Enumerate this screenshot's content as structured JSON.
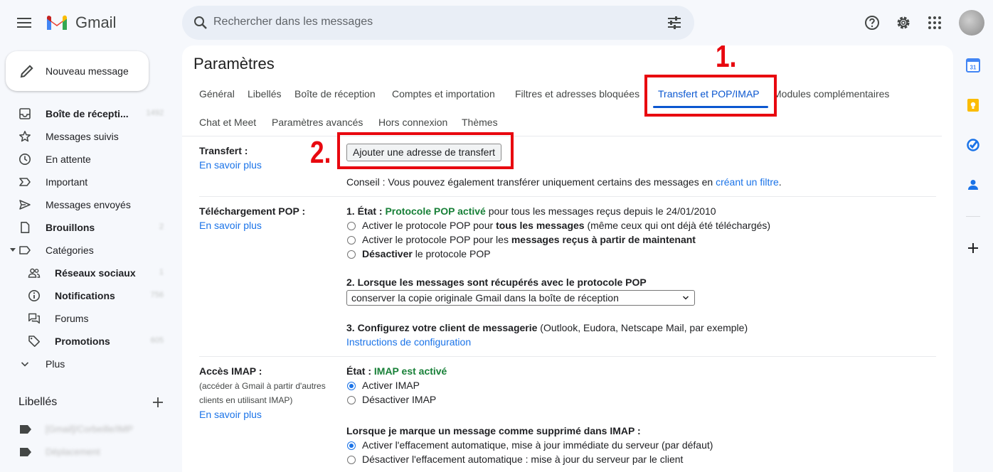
{
  "app": {
    "name": "Gmail",
    "search_placeholder": "Rechercher dans les messages"
  },
  "compose": {
    "label": "Nouveau message"
  },
  "nav": {
    "items": [
      {
        "label": "Boîte de récepti...",
        "bold": true,
        "count": "1492",
        "icon": "inbox-icon"
      },
      {
        "label": "Messages suivis",
        "bold": false,
        "count": "",
        "icon": "star-icon"
      },
      {
        "label": "En attente",
        "bold": false,
        "count": "",
        "icon": "clock-icon"
      },
      {
        "label": "Important",
        "bold": false,
        "count": "",
        "icon": "important-icon"
      },
      {
        "label": "Messages envoyés",
        "bold": false,
        "count": "",
        "icon": "send-icon"
      },
      {
        "label": "Brouillons",
        "bold": true,
        "count": "2",
        "icon": "draft-icon"
      },
      {
        "label": "Catégories",
        "bold": false,
        "count": "",
        "icon": "label-icon"
      }
    ],
    "categories": [
      {
        "label": "Réseaux sociaux",
        "bold": true,
        "count": "1",
        "icon": "people-icon"
      },
      {
        "label": "Notifications",
        "bold": true,
        "count": "756",
        "icon": "info-icon"
      },
      {
        "label": "Forums",
        "bold": false,
        "count": "",
        "icon": "forum-icon"
      },
      {
        "label": "Promotions",
        "bold": true,
        "count": "605",
        "icon": "tag-icon"
      }
    ],
    "more": "Plus",
    "labels_title": "Libellés",
    "labels": [
      {
        "name": "[Gmail]/Corbeille/IMP"
      },
      {
        "name": "Déplacement"
      }
    ]
  },
  "settings": {
    "title": "Paramètres",
    "tabs_row1": [
      "Général",
      "Libellés",
      "Boîte de réception",
      "Comptes et importation",
      "Filtres et adresses bloquées",
      "Transfert et POP/IMAP",
      "Modules complémentaires"
    ],
    "tabs_row2": [
      "Chat et Meet",
      "Paramètres avancés",
      "Hors connexion",
      "Thèmes"
    ],
    "active_tab": "Transfert et POP/IMAP",
    "learn_more": "En savoir plus",
    "forwarding": {
      "label": "Transfert :",
      "button": "Ajouter une adresse de transfert",
      "tip_prefix": "Conseil : Vous pouvez également transférer uniquement certains des messages en ",
      "tip_link": "créant un filtre",
      "tip_suffix": "."
    },
    "pop": {
      "label": "Téléchargement POP :",
      "state_prefix": "1. État : ",
      "state_value": "Protocole POP activé",
      "state_suffix": " pour tous les messages reçus depuis le 24/01/2010",
      "options": [
        {
          "pre": "Activer le protocole POP pour ",
          "bold": "tous les messages",
          "post": " (même ceux qui ont déjà été téléchargés)",
          "checked": false
        },
        {
          "pre": "Activer le protocole POP pour les ",
          "bold": "messages reçus à partir de maintenant",
          "post": "",
          "checked": false
        },
        {
          "pre": "",
          "bold": "Désactiver",
          "post": " le protocole POP",
          "checked": false
        }
      ],
      "when_title": "2. Lorsque les messages sont récupérés avec le protocole POP",
      "when_value": "conserver la copie originale Gmail dans la boîte de réception",
      "client_title": "3. Configurez votre client de messagerie",
      "client_suffix": " (Outlook, Eudora, Netscape Mail, par exemple)",
      "config_link": "Instructions de configuration"
    },
    "imap": {
      "label": "Accès IMAP :",
      "sub1": "(accéder à Gmail à partir d'autres",
      "sub2": "clients en utilisant IMAP)",
      "state_prefix": "État : ",
      "state_value": "IMAP est activé",
      "options": [
        {
          "label": "Activer IMAP",
          "checked": true
        },
        {
          "label": "Désactiver IMAP",
          "checked": false
        }
      ],
      "delete_title": "Lorsque je marque un message comme supprimé dans IMAP :",
      "delete_options": [
        {
          "label": "Activer l'effacement automatique, mise à jour immédiate du serveur (par défaut)",
          "checked": true
        },
        {
          "label": "Désactiver l'effacement automatique : mise à jour du serveur par le client",
          "checked": false
        }
      ]
    }
  },
  "annotations": {
    "one": "1.",
    "two": "2."
  },
  "colors": {
    "accent": "#0b57d0",
    "link": "#1a73e8",
    "green": "#188038",
    "annotation": "#e8080f"
  }
}
